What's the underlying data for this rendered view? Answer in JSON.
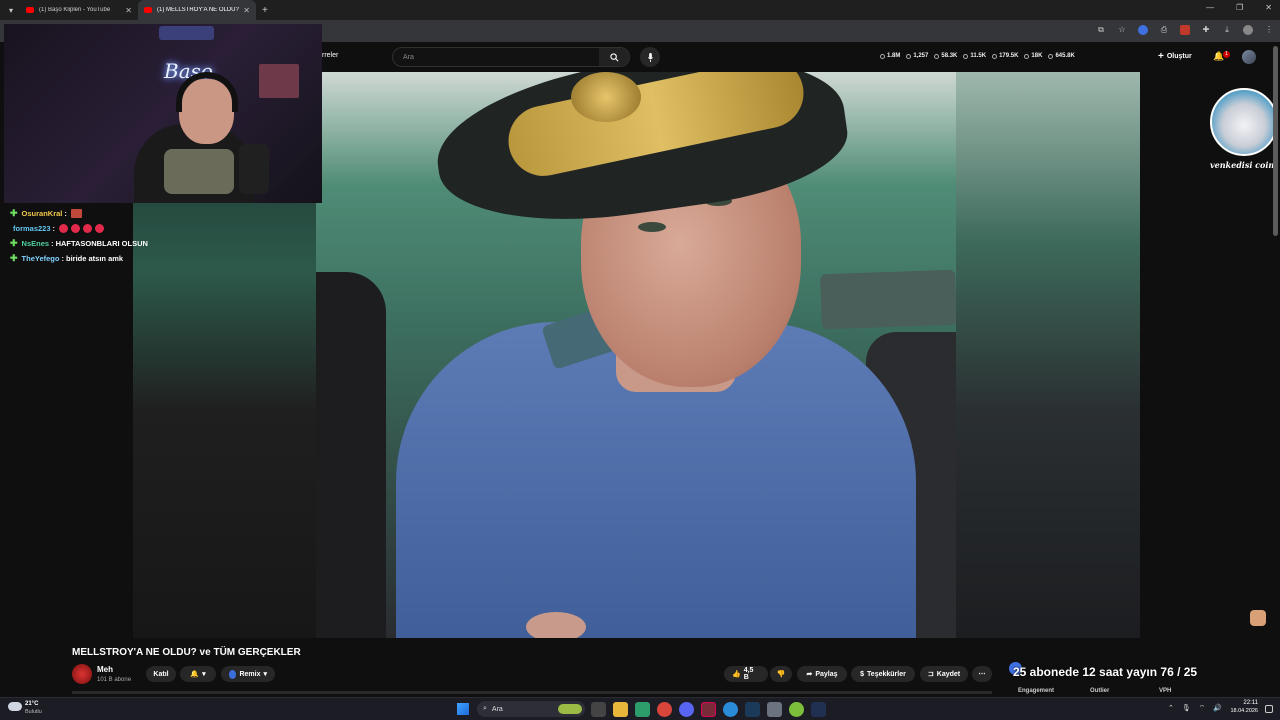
{
  "browser": {
    "tabs": [
      {
        "title": "(1) Başo Klipleri - YouTube",
        "active": false
      },
      {
        "title": "(1) MELLSTROY'A NE OLDU? ve",
        "active": true
      }
    ],
    "new_tab": "+"
  },
  "youtube_header": {
    "filters_label": "rreler",
    "search_placeholder": "Ara",
    "stats": [
      "1.8M",
      "1,257",
      "58.3K",
      "11.5K",
      "179.5K",
      "18K",
      "645.8K"
    ],
    "create_label": "Oluştur",
    "notification_count": "1"
  },
  "stream_overlay": {
    "neon_sign": "Başo",
    "chat": [
      {
        "user": "OsuranKral",
        "user_color": "#f2c94c",
        "message": "",
        "emotes": [
          "square"
        ]
      },
      {
        "user": "formas223",
        "user_color": "#63c7f2",
        "message": "",
        "emotes": [
          "dot",
          "dot",
          "dot",
          "dot"
        ],
        "no_plus": true
      },
      {
        "user": "NsEnes",
        "user_color": "#4fd1a0",
        "message": "HAFTASONBLARI OLSUN",
        "emotes": []
      },
      {
        "user": "TheYefego",
        "user_color": "#7fd3ff",
        "message": "biride atsın amk",
        "emotes": []
      }
    ],
    "right_label": "venkedisi coin",
    "goal_text": "25 abonede 12 saat yayın 76 / 25",
    "mini_tabs": [
      "Engagement",
      "Outlier",
      "VPH"
    ]
  },
  "video": {
    "title": "MELLSTROY'A NE OLDU? ve TÜM GERÇEKLER",
    "channel_name": "Meh",
    "subscribers": "101 B abone",
    "join_label": "Katıl",
    "remix_label": "Remix",
    "likes": "4,5 B",
    "share_label": "Paylaş",
    "thanks_label": "Teşekkürler",
    "save_label": "Kaydet"
  },
  "taskbar": {
    "weather_temp": "21°C",
    "weather_desc": "Bulutlu",
    "search_label": "Ara",
    "time": "22:11",
    "date": "18.04.2026"
  },
  "colors": {
    "background": "#0f0f0f",
    "chrome": "#35363a",
    "accent_red": "#ff0000",
    "chat_plus": "#6fdc62"
  }
}
